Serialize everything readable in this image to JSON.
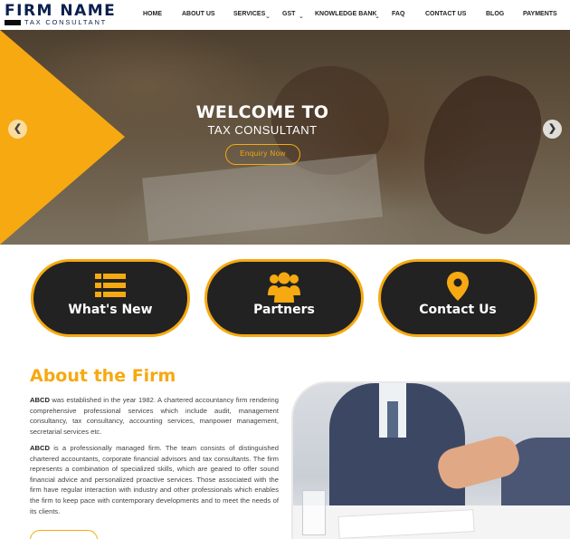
{
  "logo": {
    "title": "FIRM NAME",
    "subtitle": "TAX CONSULTANT"
  },
  "nav": {
    "items": [
      {
        "label": "HOME"
      },
      {
        "label": "ABOUT US"
      },
      {
        "label": "SERVICES"
      },
      {
        "label": "GST"
      },
      {
        "label": "KNOWLEDGE BANK"
      },
      {
        "label": "FAQ"
      },
      {
        "label": "CONTACT US"
      },
      {
        "label": "BLOG"
      },
      {
        "label": "PAYMENTS"
      }
    ]
  },
  "hero": {
    "title": "WELCOME TO",
    "subtitle": "TAX CONSULTANT",
    "button_label": "Enquiry Now",
    "prev_icon": "chevron-left-icon",
    "next_icon": "chevron-right-icon"
  },
  "features": [
    {
      "label": "What's New",
      "icon": "list-icon"
    },
    {
      "label": "Partners",
      "icon": "users-icon"
    },
    {
      "label": "Contact Us",
      "icon": "location-pin-icon"
    }
  ],
  "about": {
    "title": "About the Firm",
    "p1_lead": "ABCD",
    "p1_text": " was established in the year 1982. A chartered accountancy firm rendering comprehensive professional services which include audit, management consultancy, tax consultancy, accounting services, manpower management, secretarial services etc.",
    "p2_lead": "ABCD",
    "p2_text": " is a professionally managed firm. The team consists of distinguished chartered accountants, corporate financial advisors and tax consultants. The firm represents a combination of specialized skills, which are geared to offer sound financial advice and personalized proactive services. Those associated with the firm have regular interaction with industry and other professionals which enables the firm to keep pace with contemporary developments and to meet the needs of its clients."
  },
  "colors": {
    "accent": "#f6a911",
    "dark": "#222222",
    "brand": "#0b1f4f"
  }
}
